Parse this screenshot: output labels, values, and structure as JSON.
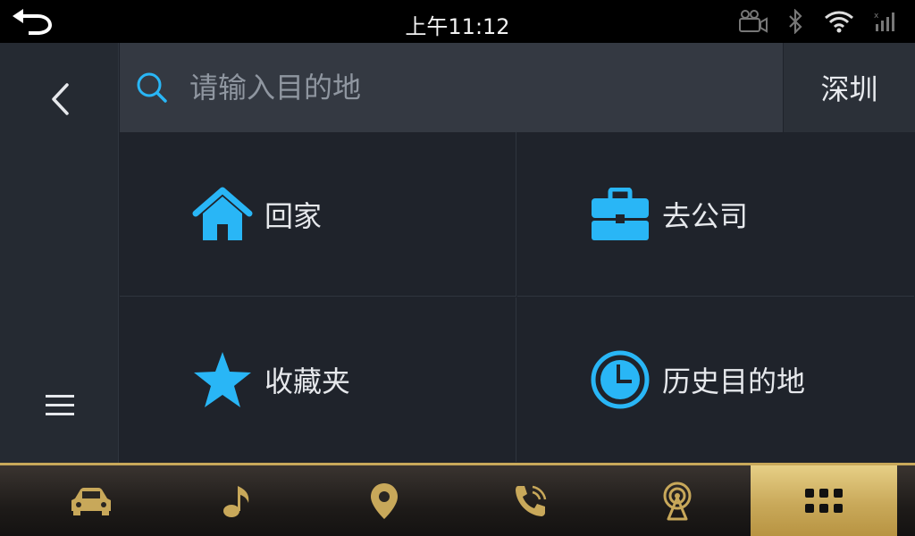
{
  "status_bar": {
    "time": "上午11:12",
    "icons": [
      "back-arrow-icon",
      "camera-icon",
      "bluetooth-icon",
      "wifi-icon",
      "signal-icon"
    ]
  },
  "left_rail": {
    "back_icon": "chevron-left-icon",
    "menu_icon": "hamburger-menu-icon"
  },
  "search": {
    "placeholder": "请输入目的地",
    "value": "",
    "city": "深圳"
  },
  "quick_destinations": [
    {
      "label": "回家",
      "icon": "home-icon"
    },
    {
      "label": "去公司",
      "icon": "briefcase-icon"
    },
    {
      "label": "收藏夹",
      "icon": "star-icon"
    },
    {
      "label": "历史目的地",
      "icon": "clock-icon"
    }
  ],
  "dock": {
    "items": [
      {
        "icon": "car-icon"
      },
      {
        "icon": "music-note-icon"
      },
      {
        "icon": "map-pin-icon"
      },
      {
        "icon": "phone-icon"
      },
      {
        "icon": "radio-tower-icon"
      },
      {
        "icon": "apps-grid-icon",
        "active": true
      }
    ]
  },
  "colors": {
    "accent_blue": "#29b6f6",
    "gold": "#c8a85a",
    "background": "#1f232b"
  }
}
